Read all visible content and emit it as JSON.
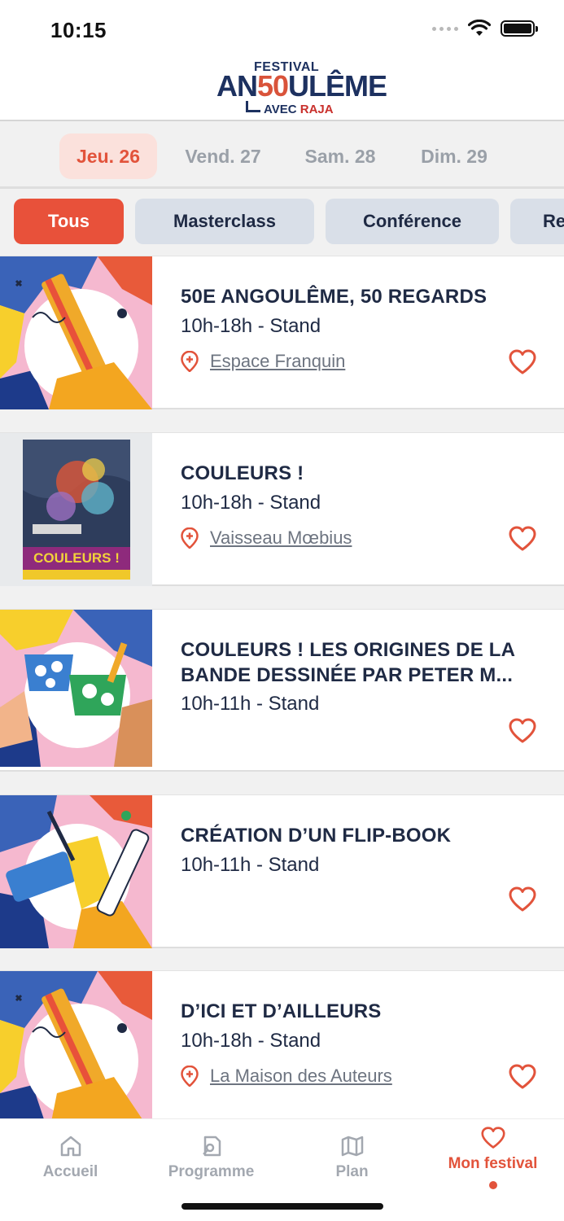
{
  "status_bar": {
    "time": "10:15"
  },
  "header": {
    "logo": {
      "top": "FESTIVAL",
      "main_left": "AN",
      "main_fifty": "50",
      "main_right": "ULÊME",
      "bottom_prefix": "AVEC ",
      "bottom_brand": "RAJA"
    }
  },
  "days": [
    {
      "label": "Jeu. 26",
      "active": true
    },
    {
      "label": "Vend. 27",
      "active": false
    },
    {
      "label": "Sam. 28",
      "active": false
    },
    {
      "label": "Dim. 29",
      "active": false
    }
  ],
  "filters": [
    {
      "label": "Tous",
      "active": true
    },
    {
      "label": "Masterclass",
      "active": false
    },
    {
      "label": "Conférence",
      "active": false
    },
    {
      "label": "Re",
      "active": false
    }
  ],
  "events": [
    {
      "title": "50E ANGOULÊME, 50 REGARDS",
      "time": "10h-18h - Stand",
      "location": "Espace Franquin",
      "thumb": "pencil-hand"
    },
    {
      "title": "COULEURS !",
      "time": "10h-18h - Stand",
      "location": "Vaisseau Mœbius",
      "thumb": "poster",
      "poster_text": "COULEURS !"
    },
    {
      "title": "COULEURS ! LES ORIGINES DE LA BANDE DESSINÉE PAR PETER M...",
      "time": "10h-11h - Stand",
      "location": "",
      "thumb": "cups"
    },
    {
      "title": "CRÉATION D’UN FLIP-BOOK",
      "time": "10h-11h - Stand",
      "location": "",
      "thumb": "paint-roller"
    },
    {
      "title": "D’ICI ET D’AILLEURS",
      "time": "10h-18h - Stand",
      "location": "La Maison des Auteurs",
      "thumb": "pencil-hand"
    }
  ],
  "tab_bar": {
    "items": [
      {
        "label": "Accueil",
        "icon": "home-icon"
      },
      {
        "label": "Programme",
        "icon": "program-icon"
      },
      {
        "label": "Plan",
        "icon": "map-icon"
      },
      {
        "label": "Mon festival",
        "icon": "heart-icon",
        "active": true
      }
    ]
  },
  "colors": {
    "accent": "#e2533b",
    "navy": "#1f2a44",
    "chip_bg": "#d9dfe8",
    "bar_bg": "#f1f1f1"
  }
}
